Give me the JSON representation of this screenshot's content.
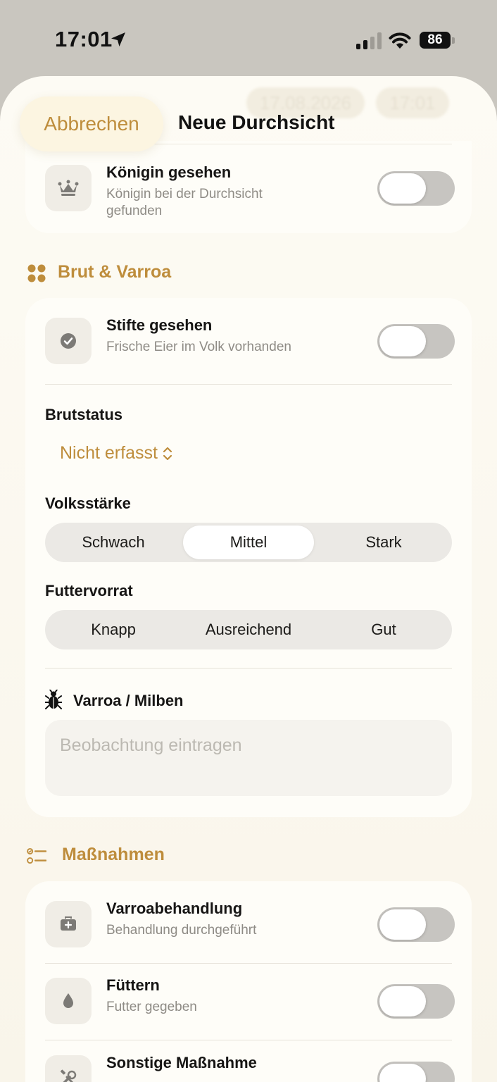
{
  "status_bar": {
    "time": "17:01",
    "battery": "86"
  },
  "header": {
    "cancel_label": "Abbrechen",
    "title": "Neue Durchsicht",
    "date_value": "17.08.2026",
    "time_value": "17:01"
  },
  "queen": {
    "title": "Königin gesehen",
    "subtitle": "Königin bei der Durchsicht gefunden",
    "enabled": false
  },
  "brut_section": {
    "title": "Brut & Varroa",
    "eggs": {
      "title": "Stifte gesehen",
      "subtitle": "Frische Eier im Volk vorhanden",
      "enabled": false
    },
    "brood_status": {
      "label": "Brutstatus",
      "value": "Nicht erfasst"
    },
    "strength": {
      "label": "Volksstärke",
      "options": [
        "Schwach",
        "Mittel",
        "Stark"
      ],
      "selected": "Mittel"
    },
    "food": {
      "label": "Futtervorrat",
      "options": [
        "Knapp",
        "Ausreichend",
        "Gut"
      ],
      "selected": ""
    },
    "varroa": {
      "label": "Varroa / Milben",
      "placeholder": "Beobachtung eintragen"
    }
  },
  "actions_section": {
    "title": "Maßnahmen",
    "items": [
      {
        "title": "Varroabehandlung",
        "subtitle": "Behandlung durchgeführt",
        "icon": "medkit-icon",
        "enabled": false
      },
      {
        "title": "Füttern",
        "subtitle": "Futter gegeben",
        "icon": "drop-icon",
        "enabled": false
      },
      {
        "title": "Sonstige Maßnahme",
        "subtitle": "",
        "icon": "tools-icon",
        "enabled": false
      }
    ]
  },
  "colors": {
    "accent": "#be8d3c",
    "sheet": "#fdfbf4",
    "card": "#fefdf8",
    "toggle_off": "#c7c5c1"
  }
}
